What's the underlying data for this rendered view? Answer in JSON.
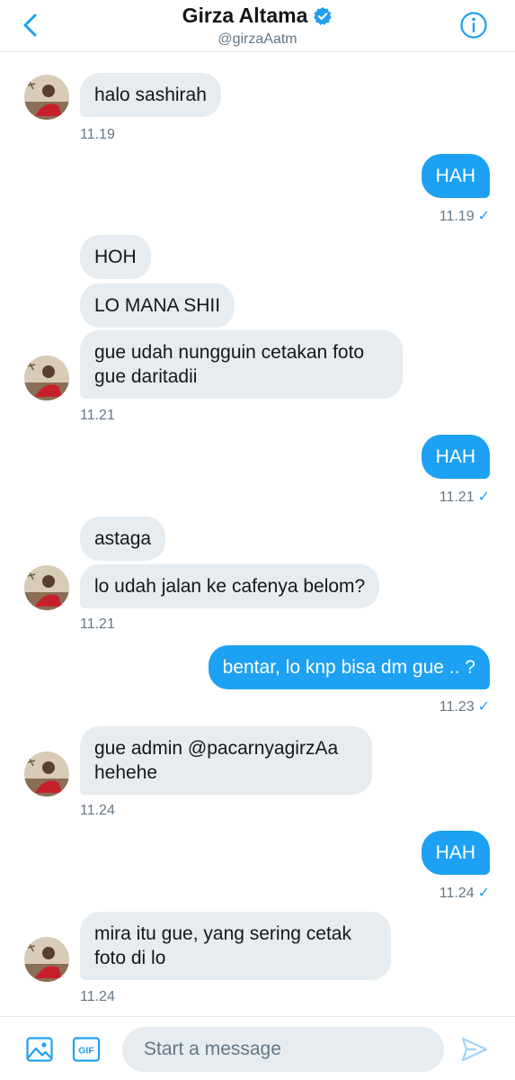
{
  "header": {
    "title": "Girza Altama",
    "handle": "@girzaAatm",
    "back_icon": "chevron-left-icon",
    "verified_icon": "verified-badge-icon",
    "info_icon": "info-icon"
  },
  "messages": [
    {
      "text": "halo sashirah",
      "time": "11.19"
    },
    {
      "text": "HAH",
      "time": "11.19"
    },
    {
      "text": "HOH"
    },
    {
      "text": "LO MANA SHII"
    },
    {
      "text": "gue udah nungguin cetakan foto gue daritadii",
      "time": "11.21"
    },
    {
      "text": "HAH",
      "time": "11.21"
    },
    {
      "text": "astaga"
    },
    {
      "text": "lo udah jalan ke cafenya belom?",
      "time": "11.21"
    },
    {
      "text": "bentar, lo knp bisa dm gue .. ?",
      "time": "11.23"
    },
    {
      "text": "gue admin @pacarnyagirzAa hehehe",
      "time": "11.24"
    },
    {
      "text": "HAH",
      "time": "11.24"
    },
    {
      "text": "mira itu gue, yang sering cetak foto di lo",
      "time": "11.24"
    }
  ],
  "read_mark": "✓",
  "composer": {
    "placeholder": "Start a message",
    "gif_label": "GIF",
    "media_icon": "image-icon",
    "send_icon": "send-icon"
  },
  "colors": {
    "accent": "#1da1f2",
    "incoming_bubble": "#e6ecf0",
    "secondary_text": "#657786"
  }
}
